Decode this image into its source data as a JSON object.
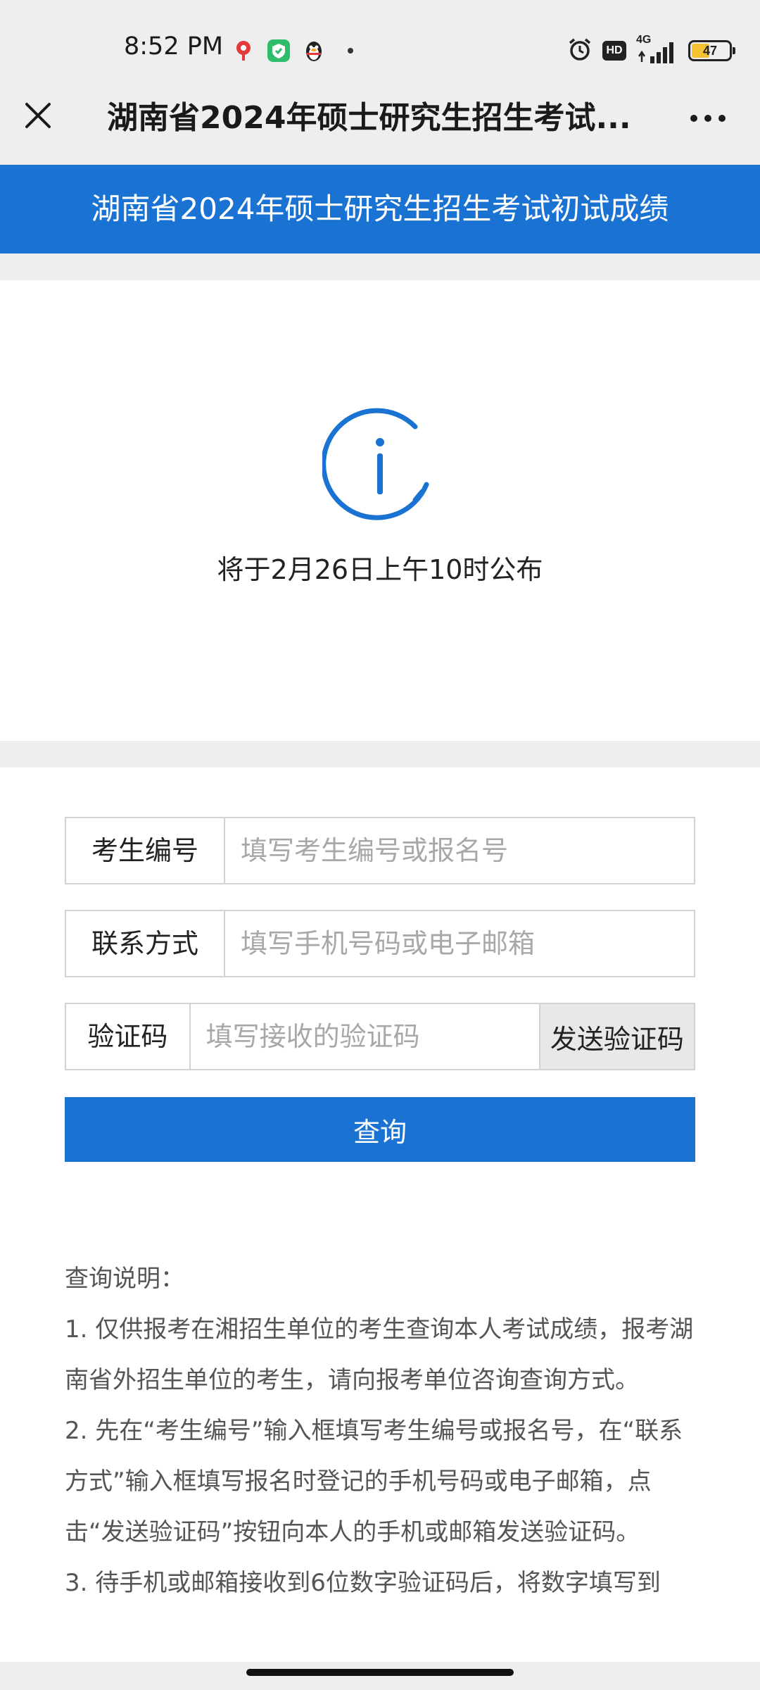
{
  "status_bar": {
    "time": "8:52 PM",
    "hd": "HD",
    "network": "4G",
    "battery": "47"
  },
  "nav": {
    "title": "湖南省2024年硕士研究生招生考试..."
  },
  "header": {
    "title": "湖南省2024年硕士研究生招生考试初试成绩"
  },
  "notice": {
    "text": "将于2月26日上午10时公布"
  },
  "form": {
    "candidate_id": {
      "label": "考生编号",
      "placeholder": "填写考生编号或报名号"
    },
    "contact": {
      "label": "联系方式",
      "placeholder": "填写手机号码或电子邮箱"
    },
    "verify_code": {
      "label": "验证码",
      "placeholder": "填写接收的验证码",
      "send_button": "发送验证码"
    },
    "query_button": "查询"
  },
  "notes": {
    "heading": "查询说明：",
    "items": [
      "1. 仅供报考在湘招生单位的考生查询本人考试成绩，报考湖南省外招生单位的考生，请向报考单位咨询查询方式。",
      "2. 先在“考生编号”输入框填写考生编号或报名号，在“联系方式”输入框填写报名时登记的手机号码或电子邮箱，点击“发送验证码”按钮向本人的手机或邮箱发送验证码。",
      "3. 待手机或邮箱接收到6位数字验证码后，将数字填写到"
    ]
  },
  "colors": {
    "accent": "#1a73d2",
    "page_bg": "#eeeeee"
  }
}
